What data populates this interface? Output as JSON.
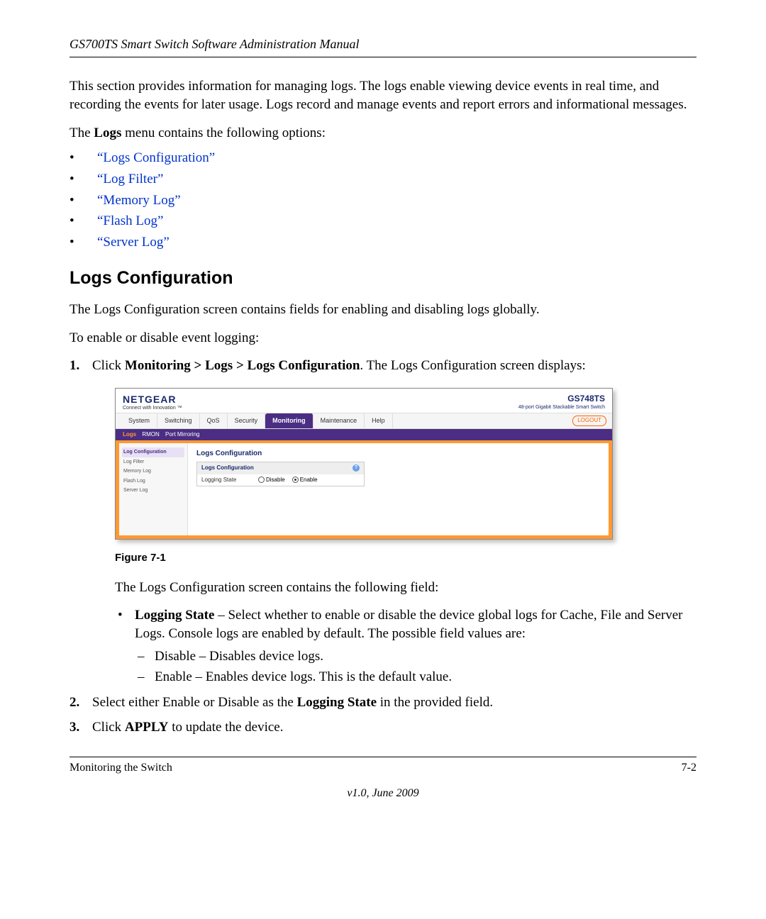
{
  "header": {
    "title": "GS700TS Smart Switch Software Administration Manual"
  },
  "intro_para": "This section provides information for managing logs. The logs enable viewing device events in real time, and recording the events for later usage. Logs record and manage events and report errors and informational messages.",
  "menu_intro_pre": "The ",
  "menu_intro_bold": "Logs",
  "menu_intro_post": " menu contains the following options:",
  "links": [
    "“Logs Configuration”",
    "“Log Filter”",
    "“Memory Log”",
    "“Flash Log”",
    "“Server Log”"
  ],
  "section_heading": "Logs Configuration",
  "section_para1": "The Logs Configuration screen contains fields for enabling and disabling logs globally.",
  "section_para2": "To enable or disable event logging:",
  "step1_pre": "Click ",
  "step1_bold": "Monitoring > Logs > Logs Configuration",
  "step1_post": ". The Logs Configuration screen displays:",
  "figure": {
    "brand": "NETGEAR",
    "brand_sub": "Connect with Innovation ™",
    "model": "GS748TS",
    "model_sub": "48-port Gigabit Stackable Smart Switch",
    "tabs": [
      "System",
      "Switching",
      "QoS",
      "Security",
      "Monitoring",
      "Maintenance",
      "Help"
    ],
    "active_tab": "Monitoring",
    "logout": "LOGOUT",
    "subtabs": [
      "Logs",
      "RMON",
      "Port Mirroring"
    ],
    "active_sub": "Logs",
    "side_items": [
      "Log Configuration",
      "Log Filter",
      "Memory Log",
      "Flash Log",
      "Server Log"
    ],
    "panel_title": "Logs Configuration",
    "panel_box_title": "Logs Configuration",
    "row_label": "Logging State",
    "opt_disable": "Disable",
    "opt_enable": "Enable",
    "caption": "Figure 7-1"
  },
  "after_figure_para": "The Logs Configuration screen contains the following field:",
  "field_bold": "Logging State",
  "field_desc": " – Select whether to enable or disable the device global logs for Cache, File and Server Logs. Console logs are enabled by default. The possible field values are:",
  "dash1": "Disable – Disables device logs.",
  "dash2": "Enable – Enables device logs. This is the default value.",
  "step2_pre": "Select either Enable or Disable as the ",
  "step2_bold": "Logging State",
  "step2_post": " in the provided field.",
  "step3_pre": "Click ",
  "step3_bold": "APPLY",
  "step3_post": " to update the device.",
  "footer": {
    "left": "Monitoring the Switch",
    "right": "7-2",
    "version": "v1.0, June 2009"
  }
}
